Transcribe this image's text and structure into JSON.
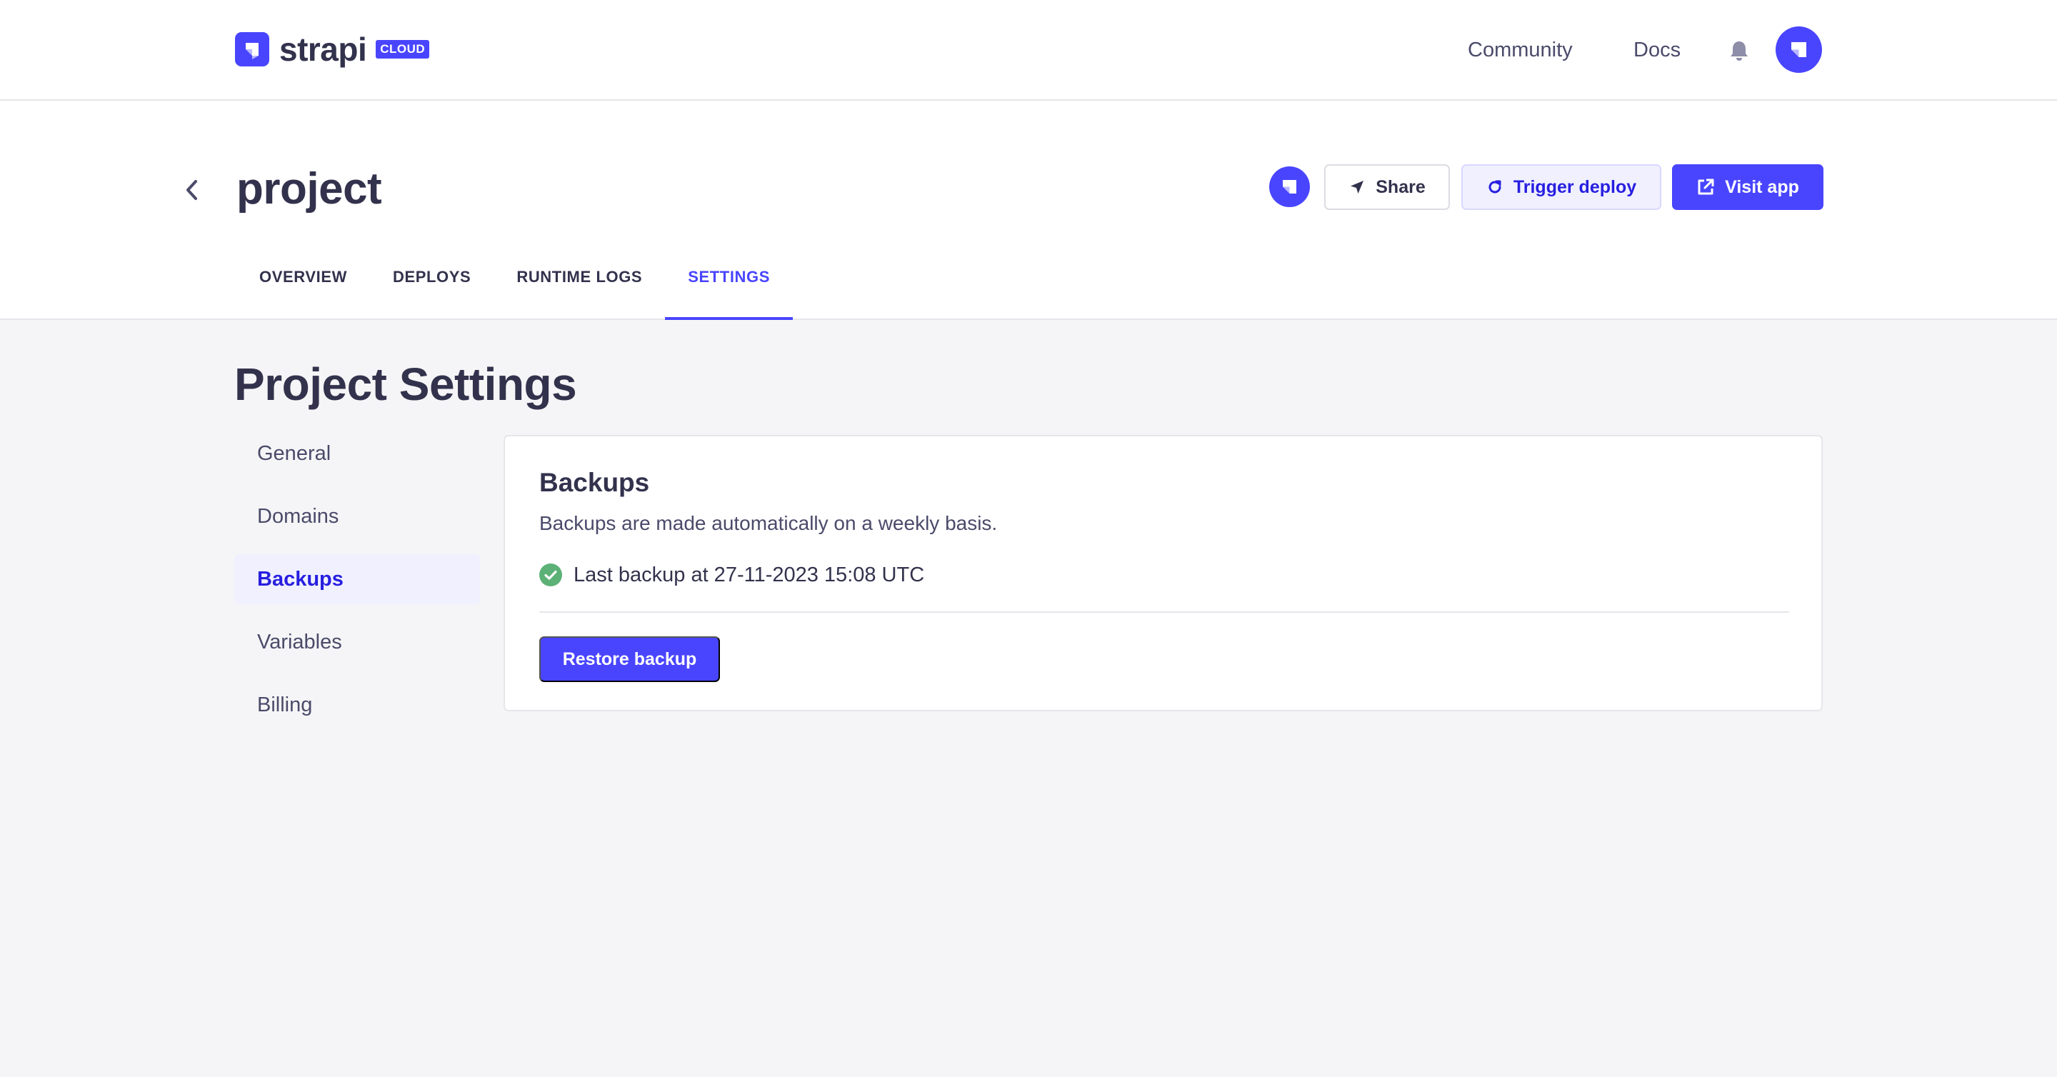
{
  "brand": {
    "name": "strapi",
    "badge": "CLOUD",
    "accent": "#4945ff"
  },
  "topnav": {
    "links": [
      "Community",
      "Docs"
    ],
    "icons": [
      "bell-icon",
      "user-avatar"
    ]
  },
  "project": {
    "name": "project",
    "actions": {
      "share": "Share",
      "trigger_deploy": "Trigger deploy",
      "visit_app": "Visit app"
    },
    "tabs": [
      {
        "label": "OVERVIEW",
        "active": false
      },
      {
        "label": "DEPLOYS",
        "active": false
      },
      {
        "label": "RUNTIME LOGS",
        "active": false
      },
      {
        "label": "SETTINGS",
        "active": true
      }
    ]
  },
  "settings": {
    "title": "Project Settings",
    "menu": [
      {
        "label": "General",
        "active": false
      },
      {
        "label": "Domains",
        "active": false
      },
      {
        "label": "Backups",
        "active": true
      },
      {
        "label": "Variables",
        "active": false
      },
      {
        "label": "Billing",
        "active": false
      }
    ],
    "backups": {
      "title": "Backups",
      "description": "Backups are made automatically on a weekly basis.",
      "status": "Last backup at 27-11-2023 15:08 UTC",
      "status_color": "#5cb176",
      "restore_label": "Restore backup"
    }
  }
}
